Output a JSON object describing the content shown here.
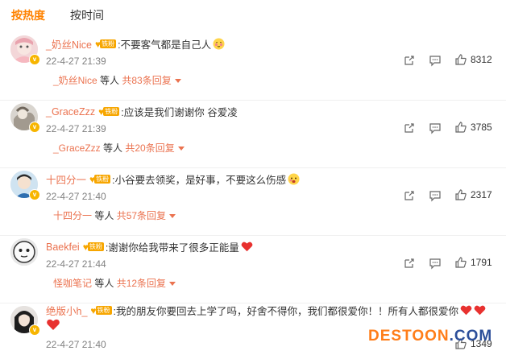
{
  "tabs": [
    {
      "label": "按热度",
      "active": true
    },
    {
      "label": "按时间",
      "active": false
    }
  ],
  "fan_badge_label": "铁粉",
  "badge_color": "#f7a600",
  "username_color": "#eb7350",
  "comments": [
    {
      "username": "_奶丝Nice",
      "text": ":不要客气都是自己人",
      "emoji": "shy-emoji",
      "time": "22-4-27 21:39",
      "likes": "8312",
      "reply_user": "_奶丝Nice",
      "reply_mid": " 等人 ",
      "reply_count": "共83条回复"
    },
    {
      "username": "_GraceZzz",
      "text": ":应该是我们谢谢你 谷爱凌",
      "time": "22-4-27 21:39",
      "likes": "3785",
      "reply_user": "_GraceZzz",
      "reply_mid": " 等人 ",
      "reply_count": "共20条回复"
    },
    {
      "username": "十四分一",
      "text": ":小谷要去领奖，是好事，不要这么伤感",
      "emoji": "sad-emoji",
      "time": "22-4-27 21:40",
      "likes": "2317",
      "reply_user": "十四分一",
      "reply_mid": " 等人 ",
      "reply_count": "共57条回复"
    },
    {
      "username": "Baekfei",
      "text": ":谢谢你给我带来了很多正能量",
      "emoji": "heart-emoji",
      "time": "22-4-27 21:44",
      "likes": "1791",
      "reply_user": "怪咖笔记",
      "reply_mid": " 等人 ",
      "reply_count": "共12条回复"
    },
    {
      "username": "绝版小h_",
      "text": ":我的朋友你要回去上学了吗，好舍不得你，我们都很爱你！！所有人都很爱你",
      "emoji": "heart-emoji",
      "time": "22-4-27 21:40",
      "likes": "1349"
    }
  ],
  "watermark": {
    "part1": "DESTOON",
    "part2": ".COM"
  }
}
